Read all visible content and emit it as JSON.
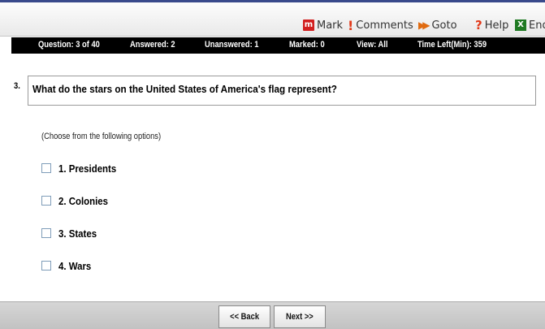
{
  "toolbar": {
    "mark": "Mark",
    "comments": "Comments",
    "goto": "Goto",
    "help": "Help",
    "end": "End",
    "icons": {
      "mark": "m",
      "comments": "!",
      "goto": "▶▶",
      "help": "?",
      "end": "X"
    }
  },
  "status": {
    "question": "Question: 3 of 40",
    "answered": "Answered: 2",
    "unanswered": "Unanswered: 1",
    "marked": "Marked: 0",
    "view": "View: All",
    "time_left": "Time Left(Min): 359"
  },
  "question": {
    "number": "3.",
    "text": "What do the stars on the United States of America's flag represent?",
    "instructions": "(Choose from the following options)",
    "options": [
      {
        "label": "1. Presidents",
        "checked": false
      },
      {
        "label": "2. Colonies",
        "checked": false
      },
      {
        "label": "3. States",
        "checked": false
      },
      {
        "label": "4. Wars",
        "checked": false
      }
    ]
  },
  "footer": {
    "back": "<< Back",
    "next": "Next >>"
  },
  "colors": {
    "status_bar": "#000000",
    "mark_icon": "#d21f1f",
    "end_icon": "#1f7a22",
    "accent_top": "#3a4a8c"
  }
}
